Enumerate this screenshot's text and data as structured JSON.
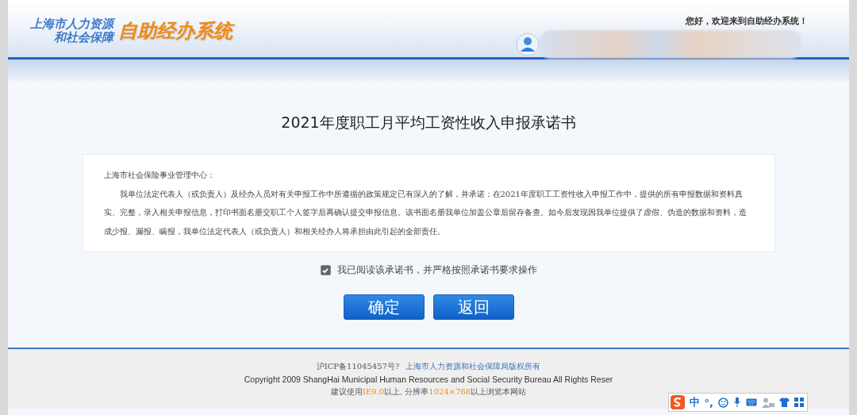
{
  "header": {
    "org_name_line1": "上海市人力资源",
    "org_name_line2": "和社会保障",
    "system_name": "自助经办系统",
    "greeting": "您好，欢迎来到自助经办系统！"
  },
  "title": "2021年度职工月平均工资性收入申报承诺书",
  "notice": {
    "addressee": "上海市社会保险事业管理中心：",
    "body": "我单位法定代表人（或负责人）及经办人员对有关申报工作中所遵循的政策规定已有深入的了解，并承诺：在2021年度职工工资性收入申报工作中，提供的所有申报数据和资料真实、完整，录入相关申报信息，打印书面名册交职工个人签字后再确认提交申报信息。该书面名册我单位加盖公章后留存备查。如今后发现因我单位提供了虚假、伪造的数据和资料，造成少报、漏报、瞒报，我单位法定代表人（或负责人）和相关经办人将承担由此引起的全部责任。"
  },
  "agreement": {
    "label": "我已阅读该承诺书，并严格按照承诺书要求操作",
    "checked": true
  },
  "buttons": [
    "确定",
    "返回"
  ],
  "footer": {
    "icp": "沪ICP备11045457号?",
    "copyright_owner": "上海市人力资源和社会保障局版权所有",
    "copyright": "Copyright 2009 ShangHai Municipal Human Resources and Social Security Bureau All Rights Reser",
    "browser_note": "建议使用**IE9.0**以上, 分辨率**1024×768**以上浏览本网站"
  },
  "ime_toolbar": {
    "language": "中",
    "punctuation": "°,"
  }
}
